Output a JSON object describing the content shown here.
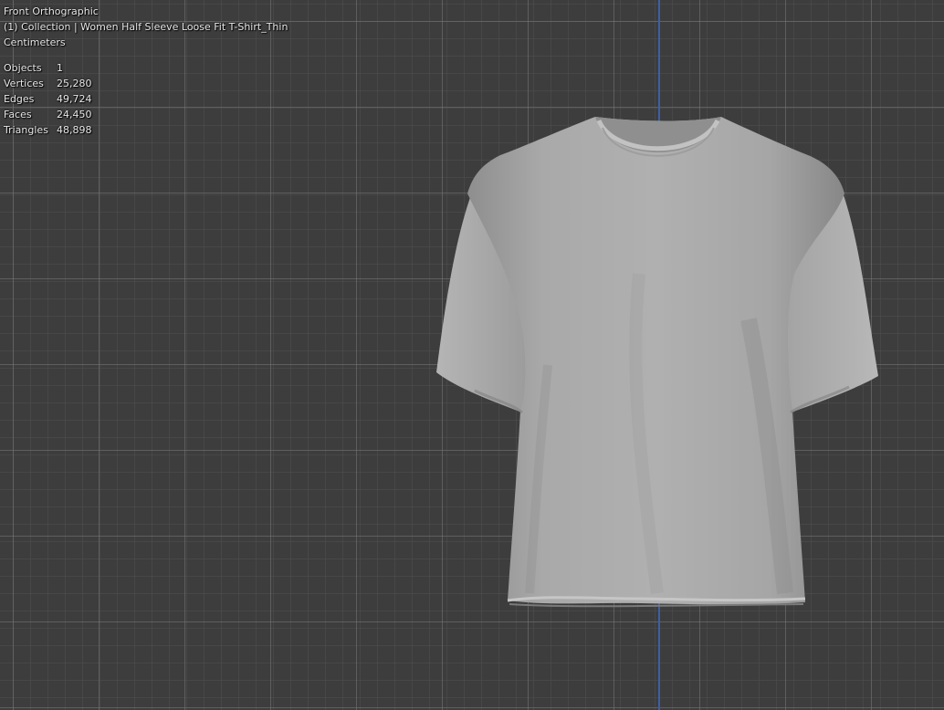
{
  "viewport": {
    "view_name": "Front Orthographic",
    "collection_line": "(1) Collection | Women Half Sleeve Loose Fit T-Shirt_Thin",
    "units": "Centimeters"
  },
  "statistics": [
    {
      "label": "Objects",
      "value": "1"
    },
    {
      "label": "Vertices",
      "value": "25,280"
    },
    {
      "label": "Edges",
      "value": "49,724"
    },
    {
      "label": "Faces",
      "value": "24,450"
    },
    {
      "label": "Triangles",
      "value": "48,898"
    }
  ],
  "colors": {
    "background": "#3d3d3d",
    "z_axis": "#3e5fa8",
    "mesh": "#a9a9a9",
    "text": "#e8e8e8"
  }
}
